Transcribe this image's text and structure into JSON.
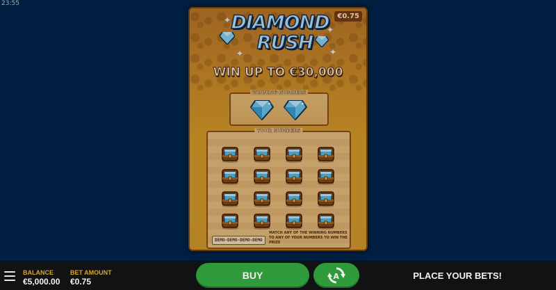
{
  "status_bar": {
    "time": "23:55"
  },
  "ticket": {
    "price": "€0.75",
    "logo_line1": "DIAMOND",
    "logo_line2": "RUSH",
    "headline": "WIN UP TO €30,000",
    "winning_numbers_label": "WINNING NUMBERS",
    "your_numbers_label": "YOUR NUMBERS",
    "winning_symbols": [
      "diamond-icon",
      "diamond-icon"
    ],
    "your_symbols_rows": 4,
    "your_symbols_cols": 4,
    "your_symbol_icon": "treasure-chest-icon",
    "demo_tag": "DEMO-DEMO-DEMO-DEMO",
    "instructions": "MATCH ANY OF THE WINNING NUMBERS TO ANY OF YOUR NUMBERS TO WIN THE PRIZE"
  },
  "bottom_bar": {
    "balance_label": "BALANCE",
    "balance_value": "€5,000.00",
    "bet_label": "BET AMOUNT",
    "bet_value": "€0.75",
    "buy_label": "BUY",
    "autoplay_icon": "autoplay-icon",
    "status_message": "PLACE YOUR BETS!"
  },
  "colors": {
    "background": "#022650",
    "ticket": "#d4902a",
    "button": "#2f9a3a",
    "label_gold": "#d8a62a",
    "bar": "#111214"
  }
}
